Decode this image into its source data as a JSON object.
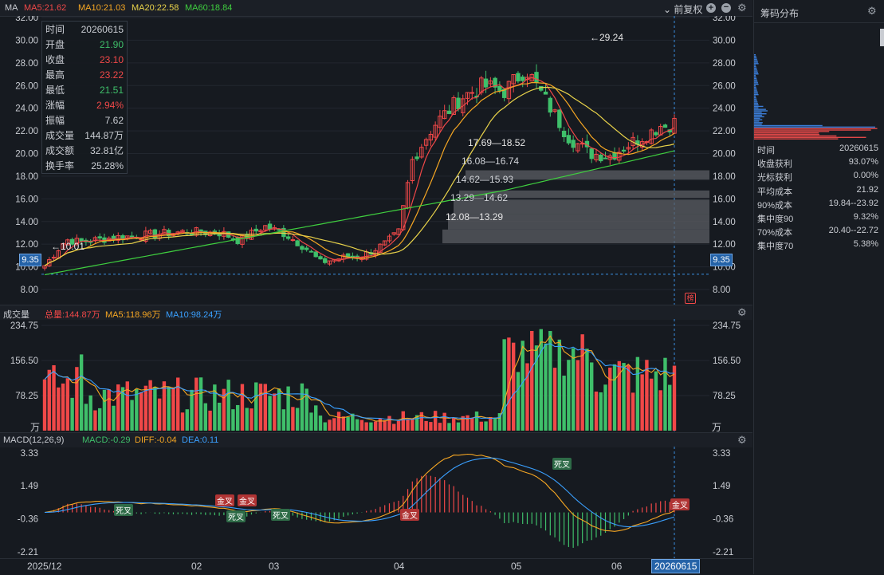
{
  "main": {
    "header": {
      "symbol": "MA",
      "ma5": "MA5:21.62",
      "ma10": "MA10:21.03",
      "ma20": "MA20:22.58",
      "ma60": "MA60:18.84",
      "adjust": "前复权"
    },
    "info_box": [
      {
        "k": "时间",
        "v": "20260615",
        "c": "#c9ccd2"
      },
      {
        "k": "开盘",
        "v": "21.90",
        "c": "#3fbf6a"
      },
      {
        "k": "收盘",
        "v": "23.10",
        "c": "#f04848"
      },
      {
        "k": "最高",
        "v": "23.22",
        "c": "#f04848"
      },
      {
        "k": "最低",
        "v": "21.51",
        "c": "#3fbf6a"
      },
      {
        "k": "涨幅",
        "v": "2.94%",
        "c": "#f04848"
      },
      {
        "k": "振幅",
        "v": "7.62",
        "c": "#c9ccd2"
      },
      {
        "k": "成交量",
        "v": "144.87万",
        "c": "#c9ccd2"
      },
      {
        "k": "成交额",
        "v": "32.81亿",
        "c": "#c9ccd2"
      },
      {
        "k": "换手率",
        "v": "25.28%",
        "c": "#c9ccd2"
      }
    ],
    "annotations": {
      "high_label": "←29.24",
      "low_label": "←10.01",
      "current_price": "9.35",
      "chip_zones": [
        "17.69—18.52",
        "16.08—16.74",
        "14.62—15.93",
        "13.29—14.62",
        "12.08—13.29"
      ],
      "badge": "榜"
    }
  },
  "volume": {
    "title": "成交量",
    "total": "总量:144.87万",
    "ma5": "MA5:118.96万",
    "ma10": "MA10:98.24万",
    "unit": "万"
  },
  "macd": {
    "title": "MACD(12,26,9)",
    "macd": "MACD:-0.29",
    "diff": "DIFF:-0.04",
    "dea": "DEA:0.11",
    "signals": [
      "死叉",
      "金叉",
      "金叉",
      "死叉",
      "死叉",
      "金叉",
      "死叉",
      "金叉"
    ]
  },
  "xaxis": {
    "labels": [
      "2025/12",
      "02",
      "03",
      "04",
      "05",
      "06"
    ],
    "cursor": "20260615"
  },
  "sidebar": {
    "title": "筹码分布",
    "rows": [
      {
        "k": "时间",
        "v": "20260615"
      },
      {
        "k": "收盘获利",
        "v": "93.07%"
      },
      {
        "k": "光标获利",
        "v": "0.00%"
      },
      {
        "k": "平均成本",
        "v": "21.92"
      },
      {
        "k": "90%成本",
        "v": "19.84--23.92"
      },
      {
        "k": "集中度90",
        "v": "9.32%"
      },
      {
        "k": "70%成本",
        "v": "20.40--22.72"
      },
      {
        "k": "集中度70",
        "v": "5.38%"
      }
    ]
  },
  "colors": {
    "up": "#f04848",
    "down": "#3fbf6a",
    "ma5": "#f04848",
    "ma10": "#f5a623",
    "ma20": "#e8d24a",
    "ma60": "#3fcf3f",
    "diff": "#f5a623",
    "dea": "#3aa0ff"
  },
  "chart_data": [
    {
      "type": "line",
      "title": "MA",
      "ylim": [
        8,
        32
      ],
      "y_ticks": [
        8,
        10,
        12,
        14,
        16,
        18,
        20,
        22,
        24,
        26,
        28,
        30,
        32
      ],
      "series": [
        {
          "name": "MA60",
          "values": [
            9.3,
            9.8,
            10.4,
            11.0,
            11.5,
            12.0,
            12.1,
            12.2,
            12.0,
            12.2,
            14.5,
            16.5,
            18.1,
            18.8,
            19.5
          ]
        },
        {
          "name": "MA20",
          "values": [
            10.2,
            11.8,
            12.4,
            12.8,
            13.0,
            13.2,
            13.0,
            11.5,
            10.8,
            11.3,
            16.0,
            22.0,
            25.0,
            22.8,
            22.6
          ]
        },
        {
          "name": "MA10",
          "values": [
            10.4,
            12.0,
            12.7,
            13.0,
            13.4,
            13.3,
            12.6,
            11.0,
            10.9,
            11.6,
            21.0,
            25.0,
            25.0,
            21.0,
            21.0
          ]
        },
        {
          "name": "MA5",
          "values": [
            10.5,
            12.2,
            12.8,
            13.2,
            13.5,
            13.0,
            12.4,
            10.8,
            11.0,
            11.8,
            22.0,
            25.5,
            24.5,
            20.5,
            21.6
          ]
        }
      ],
      "x": [
        "2025/12",
        "",
        "02",
        "",
        "03",
        "",
        "",
        "04",
        "",
        "",
        "",
        "05",
        "",
        "06",
        "20260615"
      ]
    },
    {
      "type": "bar",
      "title": "成交量",
      "ylim": [
        0,
        234.75
      ],
      "y_ticks": [
        78.25,
        156.5,
        234.75
      ],
      "series": [
        {
          "name": "MA5",
          "values": [
            50,
            100,
            110,
            90,
            70,
            70,
            60,
            40,
            30,
            30,
            180,
            200,
            150,
            90,
            119
          ]
        },
        {
          "name": "MA10",
          "values": [
            40,
            80,
            100,
            90,
            75,
            65,
            55,
            42,
            30,
            28,
            120,
            180,
            160,
            100,
            98
          ]
        }
      ]
    },
    {
      "type": "bar",
      "title": "MACD(12,26,9)",
      "ylim": [
        -2.21,
        3.33
      ],
      "y_ticks": [
        3.33,
        1.49,
        -0.36,
        -2.21
      ]
    }
  ]
}
